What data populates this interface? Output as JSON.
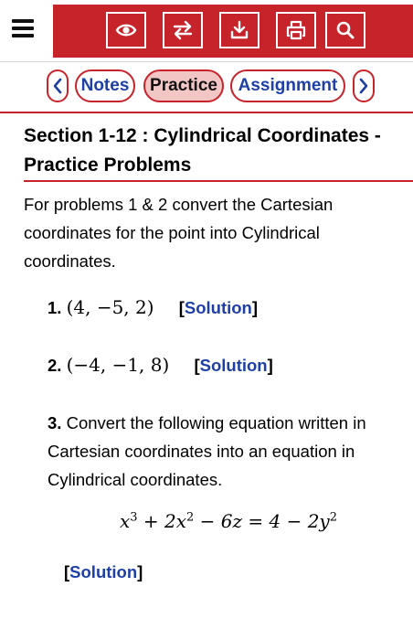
{
  "toolbar": {
    "icons": [
      "menu-icon",
      "eye-icon",
      "swap-icon",
      "download-icon",
      "print-icon",
      "search-icon"
    ],
    "brand_color": "#c7232b"
  },
  "tabs": {
    "prev_icon": "chevron-left-icon",
    "next_icon": "chevron-right-icon",
    "notes_label": "Notes",
    "practice_label": "Practice",
    "assignment_label": "Assignment",
    "active": "Practice"
  },
  "page": {
    "title": "Section 1-12 : Cylindrical Coordinates - Practice Problems",
    "intro": "For problems 1 & 2 convert the Cartesian coordinates for the point into Cylindrical coordinates."
  },
  "problems": [
    {
      "number": "1.",
      "math": "(4, −5, 2)",
      "solution_label": "Solution"
    },
    {
      "number": "2.",
      "math": "(−4, −1, 8)",
      "solution_label": "Solution"
    },
    {
      "number": "3.",
      "text": "Convert the following equation written in Cartesian coordinates into an equation in Cylindrical coordinates.",
      "solution_label": "Solution"
    }
  ],
  "equation": {
    "x": "x",
    "x_exp": "3",
    "plus_2x": " + 2x",
    "x2_exp": "2",
    "minus_6z": " − 6z = 4 − 2y",
    "y_exp": "2"
  },
  "links": {
    "accent": "#1d3fa6"
  }
}
